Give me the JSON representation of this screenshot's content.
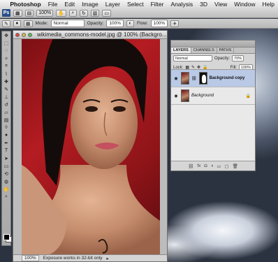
{
  "menubar": {
    "apple": "",
    "items": [
      "Photoshop",
      "File",
      "Edit",
      "Image",
      "Layer",
      "Select",
      "Filter",
      "Analysis",
      "3D",
      "View",
      "Window",
      "Help"
    ]
  },
  "appbar": {
    "logo": "Ps",
    "zoom": "100%"
  },
  "options_bar": {
    "mode_label": "Mode:",
    "mode_value": "Normal",
    "opacity_label": "Opacity:",
    "opacity_value": "100%",
    "flow_label": "Flow:",
    "flow_value": "100%"
  },
  "document": {
    "title": "wikimedia_commons-model.jpg @ 100% (Backgro...",
    "zoom": "100%",
    "status_text": "Exposure works in 32-bit only"
  },
  "layers_panel": {
    "tabs": [
      "LAYERS",
      "CHANNELS",
      "PATHS"
    ],
    "blend_mode": "Normal",
    "opacity_label": "Opacity:",
    "opacity_value": "70%",
    "lock_label": "Lock:",
    "fill_label": "Fill:",
    "fill_value": "100%",
    "layers": [
      {
        "name": "Background copy",
        "selected": true
      },
      {
        "name": "Background",
        "selected": false
      }
    ],
    "footer_icons": [
      "link-icon",
      "fx-icon",
      "mask-icon",
      "adjustment-icon",
      "folder-icon",
      "new-layer-icon",
      "trash-icon"
    ]
  },
  "colors": {
    "canvas_bg": "#b41c22",
    "selection": "#b9c9e6",
    "ps_blue": "#2a4f86"
  }
}
